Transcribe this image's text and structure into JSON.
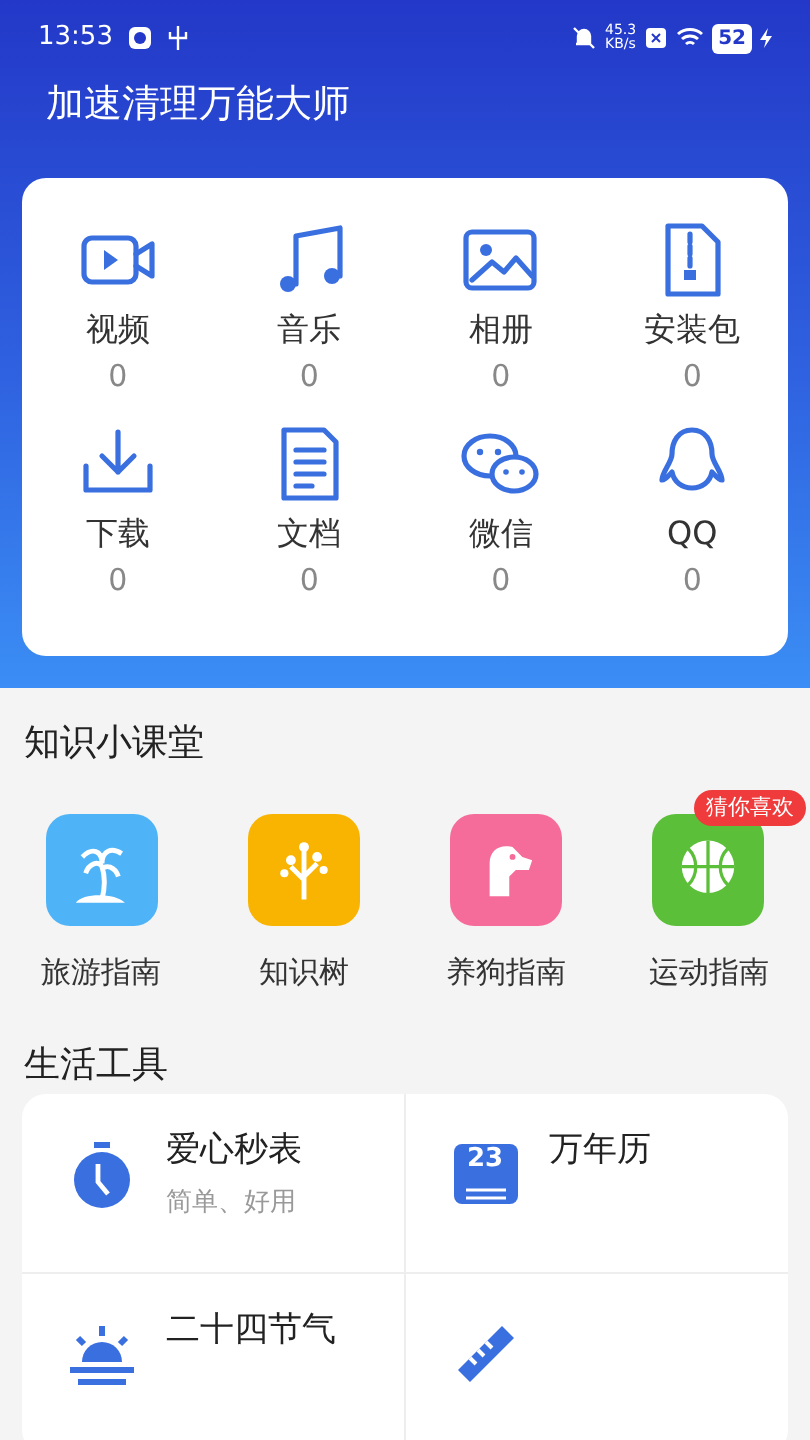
{
  "status_bar": {
    "time": "13:53",
    "net_speed": "45.3",
    "net_unit": "KB/s",
    "battery": "52"
  },
  "app": {
    "title": "加速清理万能大师"
  },
  "categories": [
    {
      "kind": "video",
      "label": "视频",
      "count": "0"
    },
    {
      "kind": "music",
      "label": "音乐",
      "count": "0"
    },
    {
      "kind": "album",
      "label": "相册",
      "count": "0"
    },
    {
      "kind": "package",
      "label": "安装包",
      "count": "0"
    },
    {
      "kind": "download",
      "label": "下载",
      "count": "0"
    },
    {
      "kind": "document",
      "label": "文档",
      "count": "0"
    },
    {
      "kind": "wechat",
      "label": "微信",
      "count": "0"
    },
    {
      "kind": "qq",
      "label": "QQ",
      "count": "0"
    }
  ],
  "knowledge": {
    "title": "知识小课堂",
    "items": [
      {
        "kind": "travel",
        "label": "旅游指南",
        "color": "#4fb3f7"
      },
      {
        "kind": "tree",
        "label": "知识树",
        "color": "#f8b400"
      },
      {
        "kind": "dog",
        "label": "养狗指南",
        "color": "#f56c9a"
      },
      {
        "kind": "sport",
        "label": "运动指南",
        "color": "#5cbf3a",
        "badge": "猜你喜欢"
      }
    ]
  },
  "tools": {
    "title": "生活工具",
    "items": [
      {
        "kind": "stopwatch",
        "title": "爱心秒表",
        "subtitle": "简单、好用"
      },
      {
        "kind": "calendar",
        "title": "万年历",
        "icon_text": "23"
      },
      {
        "kind": "solar",
        "title": "二十四节气"
      },
      {
        "kind": "ruler"
      }
    ]
  }
}
